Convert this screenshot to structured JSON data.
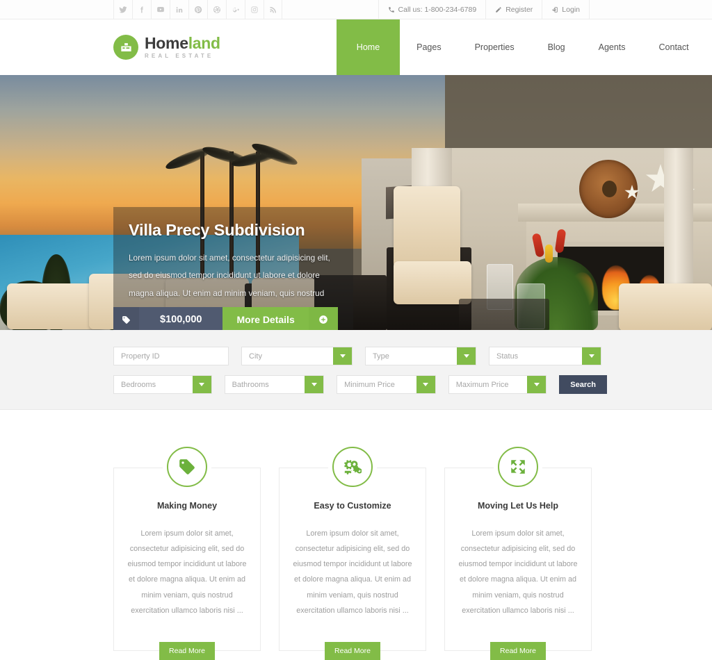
{
  "topbar": {
    "social": [
      {
        "name": "twitter-icon",
        "label": "Twitter"
      },
      {
        "name": "facebook-icon",
        "label": "Facebook"
      },
      {
        "name": "youtube-icon",
        "label": "YouTube"
      },
      {
        "name": "linkedin-icon",
        "label": "LinkedIn"
      },
      {
        "name": "pinterest-icon",
        "label": "Pinterest"
      },
      {
        "name": "dribbble-icon",
        "label": "Dribbble"
      },
      {
        "name": "google-plus-icon",
        "label": "Google Plus"
      },
      {
        "name": "instagram-icon",
        "label": "Instagram"
      },
      {
        "name": "rss-icon",
        "label": "RSS"
      }
    ],
    "phone": "Call us: 1-800-234-6789",
    "register": "Register",
    "login": "Login"
  },
  "brand": {
    "name_dark": "Home",
    "name_green": "land",
    "tagline": "REAL ESTATE"
  },
  "nav": {
    "items": [
      {
        "label": "Home",
        "active": true
      },
      {
        "label": "Pages",
        "active": false
      },
      {
        "label": "Properties",
        "active": false
      },
      {
        "label": "Blog",
        "active": false
      },
      {
        "label": "Agents",
        "active": false
      },
      {
        "label": "Contact",
        "active": false
      }
    ]
  },
  "hero": {
    "title": "Villa Precy Subdivision",
    "description": "Lorem ipsum dolor sit amet, consectetur adipisicing elit, sed do eiusmod tempor incididunt ut labore et dolore magna aliqua. Ut enim ad minim veniam, quis nostrud exercitation ullamco laboris nisi ...",
    "price": "$100,000",
    "more_details": "More Details"
  },
  "search": {
    "property_id_placeholder": "Property ID",
    "city": "City",
    "type": "Type",
    "status": "Status",
    "bedrooms": "Bedrooms",
    "bathrooms": "Bathrooms",
    "minimum_price": "Minimum Price",
    "maximum_price": "Maximum Price",
    "search_label": "Search"
  },
  "features": {
    "cards": [
      {
        "icon": "tag-icon",
        "title": "Making Money",
        "text": "Lorem ipsum dolor sit amet, consectetur adipisicing elit, sed do eiusmod tempor incididunt ut labore et dolore magna aliqua. Ut enim ad minim veniam, quis nostrud exercitation ullamco laboris nisi ...",
        "button": "Read More"
      },
      {
        "icon": "cogs-icon",
        "title": "Easy to Customize",
        "text": "Lorem ipsum dolor sit amet, consectetur adipisicing elit, sed do eiusmod tempor incididunt ut labore et dolore magna aliqua. Ut enim ad minim veniam, quis nostrud exercitation ullamco laboris nisi ...",
        "button": "Read More"
      },
      {
        "icon": "expand-arrows-icon",
        "title": "Moving Let Us Help",
        "text": "Lorem ipsum dolor sit amet, consectetur adipisicing elit, sed do eiusmod tempor incididunt ut labore et dolore magna aliqua. Ut enim ad minim veniam, quis nostrud exercitation ullamco laboris nisi ...",
        "button": "Read More"
      }
    ]
  },
  "colors": {
    "accent_green": "#82bc47",
    "dark_slate": "#4b5468",
    "search_button": "#414b60",
    "body_text": "#9d9d9d"
  }
}
